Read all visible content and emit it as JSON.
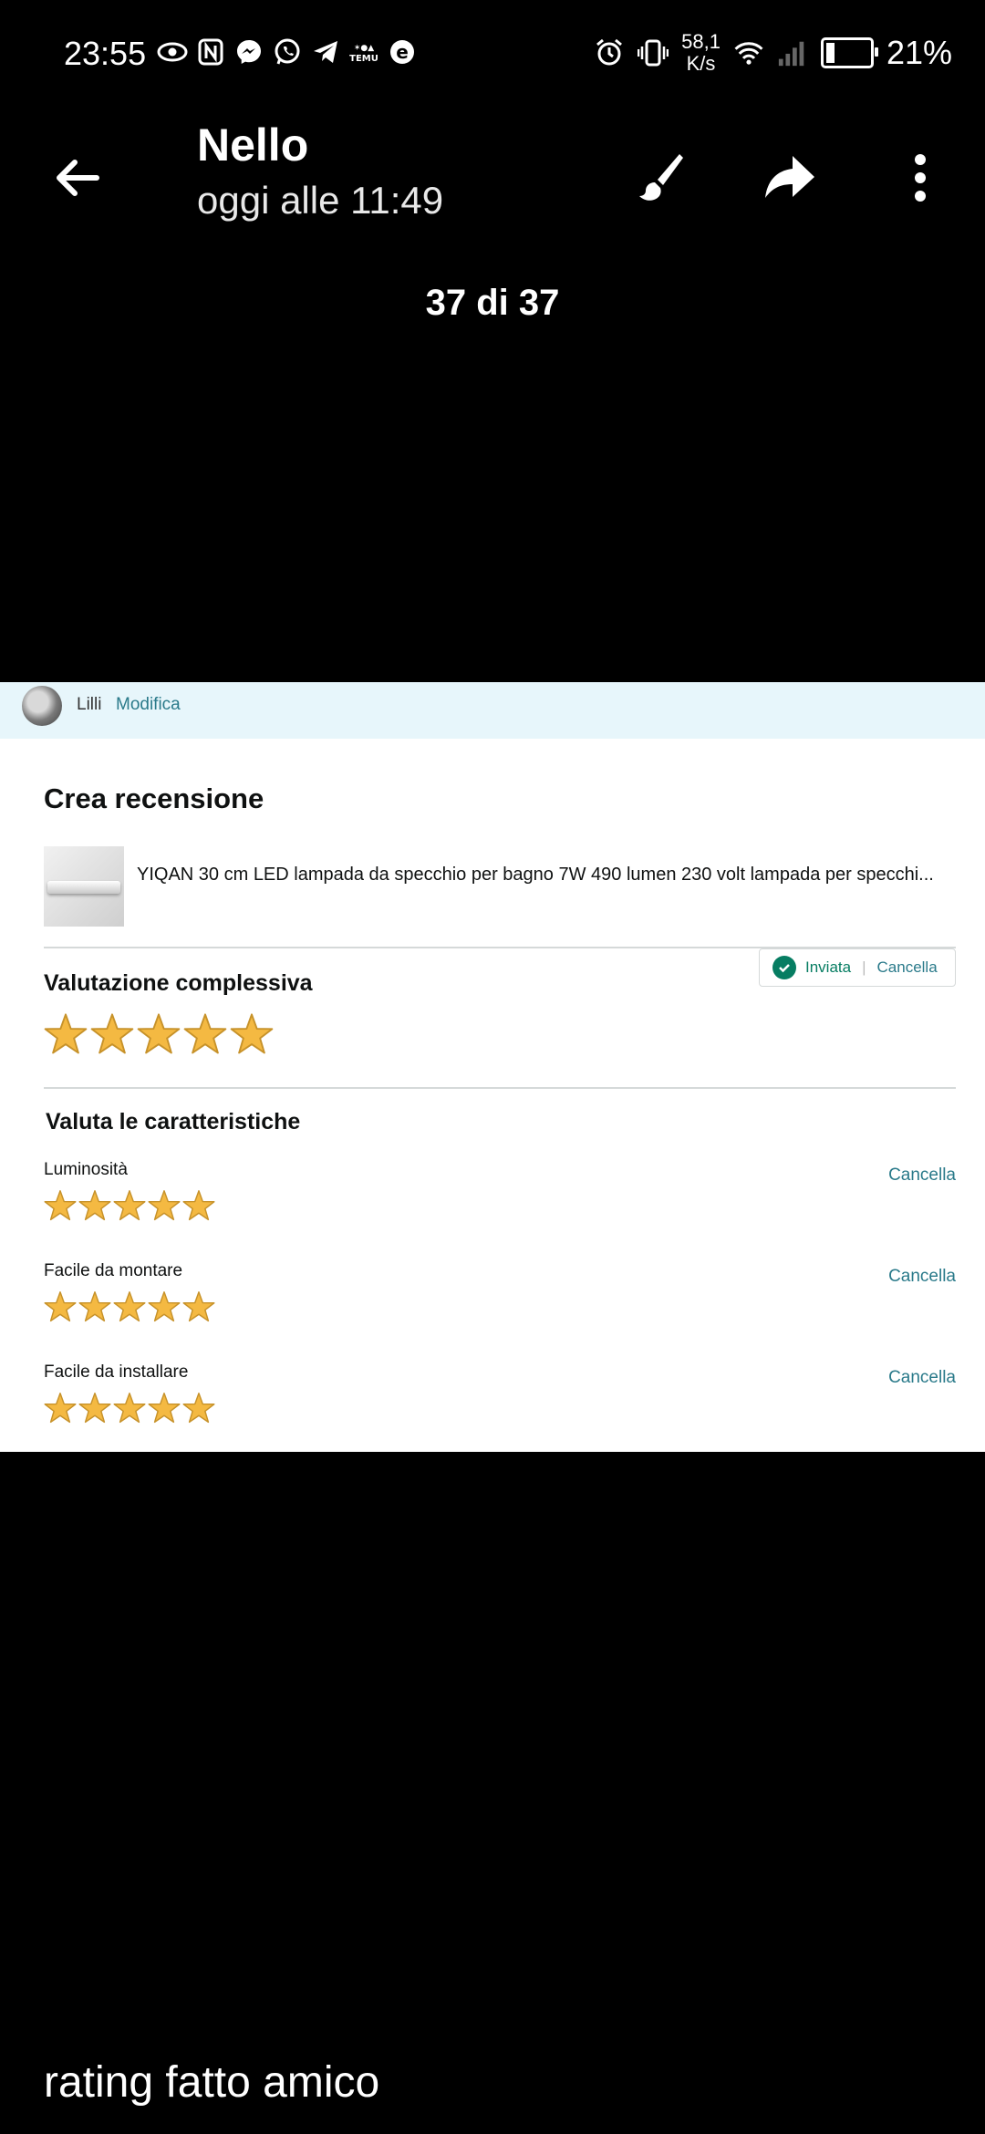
{
  "status_bar": {
    "time": "23:55",
    "left_icons": [
      "eye-icon",
      "nfc-icon",
      "messenger-icon",
      "whatsapp-icon",
      "telegram-icon",
      "temu-icon",
      "app-e-icon"
    ],
    "net_speed_value": "58,1",
    "net_speed_unit": "K/s",
    "battery_percent": "21%",
    "battery_level": 0.21
  },
  "header": {
    "title": "Nello",
    "subtitle": "oggi alle 11:49",
    "counter": "37 di 37",
    "icons": [
      "back-arrow-icon",
      "brush-icon",
      "share-arrow-icon",
      "more-vert-icon"
    ]
  },
  "shot": {
    "user": "Lilli",
    "edit_link": "Modifica",
    "heading": "Crea recensione",
    "product_title": "YIQAN 30 cm LED lampada da specchio per bagno 7W 490 lumen 230 volt lampada per specchi...",
    "overall_label": "Valutazione complessiva",
    "overall_rating": 5,
    "status_sent": "Inviata",
    "status_cancel": "Cancella",
    "features_heading": "Valuta le caratteristiche",
    "features": [
      {
        "label": "Luminosità",
        "rating": 5,
        "cancel": "Cancella"
      },
      {
        "label": "Facile da montare",
        "rating": 5,
        "cancel": "Cancella"
      },
      {
        "label": "Facile da installare",
        "rating": 5,
        "cancel": "Cancella"
      }
    ],
    "star_color": "#f4b942"
  },
  "caption": "rating fatto amico"
}
